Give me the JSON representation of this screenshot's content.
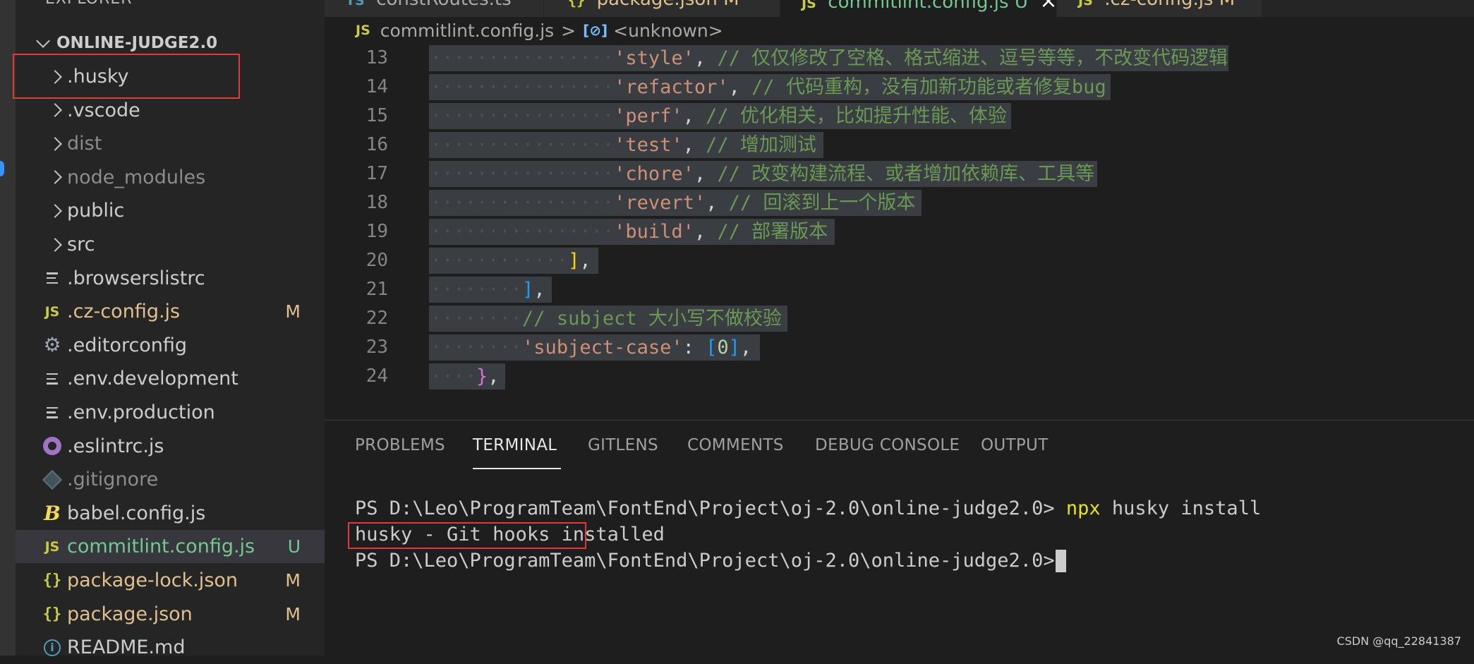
{
  "explorer": {
    "title": "EXPLORER",
    "root": "ONLINE-JUDGE2.0",
    "items": [
      {
        "label": ".husky",
        "kind": "folder",
        "badge": ""
      },
      {
        "label": ".vscode",
        "kind": "folder",
        "badge": ""
      },
      {
        "label": "dist",
        "kind": "folder",
        "badge": ""
      },
      {
        "label": "node_modules",
        "kind": "folder",
        "badge": ""
      },
      {
        "label": "public",
        "kind": "folder",
        "badge": ""
      },
      {
        "label": "src",
        "kind": "folder",
        "badge": ""
      },
      {
        "label": ".browserslistrc",
        "kind": "text",
        "badge": ""
      },
      {
        "label": ".cz-config.js",
        "kind": "js",
        "badge": "M"
      },
      {
        "label": ".editorconfig",
        "kind": "gear",
        "badge": ""
      },
      {
        "label": ".env.development",
        "kind": "text",
        "badge": ""
      },
      {
        "label": ".env.production",
        "kind": "text",
        "badge": ""
      },
      {
        "label": ".eslintrc.js",
        "kind": "eslint",
        "badge": ""
      },
      {
        "label": ".gitignore",
        "kind": "git",
        "badge": ""
      },
      {
        "label": "babel.config.js",
        "kind": "babel",
        "badge": ""
      },
      {
        "label": "commitlint.config.js",
        "kind": "js",
        "badge": "U"
      },
      {
        "label": "package-lock.json",
        "kind": "json",
        "badge": "M"
      },
      {
        "label": "package.json",
        "kind": "json",
        "badge": "M"
      },
      {
        "label": "README.md",
        "kind": "info",
        "badge": ""
      }
    ],
    "icon_text": {
      "js": "JS",
      "json": "{}",
      "babel": "B",
      "gear": "⚙",
      "info": "i"
    }
  },
  "tabs": [
    {
      "icon": "TS",
      "label": "constRoutes.ts",
      "badge": ""
    },
    {
      "icon": "{}",
      "label": "package.json",
      "badge": "M"
    },
    {
      "icon": "JS",
      "label": "commitlint.config.js",
      "badge": "U"
    },
    {
      "icon": "JS",
      "label": ".cz-config.js",
      "badge": "M"
    }
  ],
  "tab_close_glyph": "×",
  "breadcrumb": {
    "js_icon": "JS",
    "file": "commitlint.config.js",
    "separator": ">",
    "symbol_icon": "[⊘]",
    "symbol": "<unknown>"
  },
  "editor": {
    "lines": [
      {
        "n": "13",
        "ws": "················",
        "parts": [
          [
            "str",
            "'style'"
          ],
          [
            "pun",
            ", "
          ],
          [
            "cm",
            "// 仅仅修改了空格、格式缩进、逗号等等，不改变代码逻辑"
          ]
        ]
      },
      {
        "n": "14",
        "ws": "················",
        "parts": [
          [
            "str",
            "'refactor'"
          ],
          [
            "pun",
            ", "
          ],
          [
            "cm",
            "// 代码重构，没有加新功能或者修复bug"
          ]
        ]
      },
      {
        "n": "15",
        "ws": "················",
        "parts": [
          [
            "str",
            "'perf'"
          ],
          [
            "pun",
            ", "
          ],
          [
            "cm",
            "// 优化相关，比如提升性能、体验"
          ]
        ]
      },
      {
        "n": "16",
        "ws": "················",
        "parts": [
          [
            "str",
            "'test'"
          ],
          [
            "pun",
            ", "
          ],
          [
            "cm",
            "// 增加测试"
          ]
        ]
      },
      {
        "n": "17",
        "ws": "················",
        "parts": [
          [
            "str",
            "'chore'"
          ],
          [
            "pun",
            ", "
          ],
          [
            "cm",
            "// 改变构建流程、或者增加依赖库、工具等"
          ]
        ]
      },
      {
        "n": "18",
        "ws": "················",
        "parts": [
          [
            "str",
            "'revert'"
          ],
          [
            "pun",
            ", "
          ],
          [
            "cm",
            "// 回滚到上一个版本"
          ]
        ]
      },
      {
        "n": "19",
        "ws": "················",
        "parts": [
          [
            "str",
            "'build'"
          ],
          [
            "pun",
            ", "
          ],
          [
            "cm",
            "// 部署版本"
          ]
        ]
      },
      {
        "n": "20",
        "ws": "············",
        "parts": [
          [
            "br-y",
            "]"
          ],
          [
            "pun",
            ","
          ]
        ]
      },
      {
        "n": "21",
        "ws": "········",
        "parts": [
          [
            "br-b",
            "]"
          ],
          [
            "pun",
            ","
          ]
        ]
      },
      {
        "n": "22",
        "ws": "········",
        "parts": [
          [
            "cm",
            "// subject 大小写不做校验"
          ]
        ]
      },
      {
        "n": "23",
        "ws": "········",
        "parts": [
          [
            "str",
            "'subject-case'"
          ],
          [
            "pun",
            ": "
          ],
          [
            "br-b",
            "["
          ],
          [
            "num",
            "0"
          ],
          [
            "br-b",
            "]"
          ],
          [
            "pun",
            ","
          ]
        ]
      },
      {
        "n": "24",
        "ws": "····",
        "parts": [
          [
            "br-p",
            "}"
          ],
          [
            "pun",
            ","
          ]
        ]
      }
    ]
  },
  "panel": {
    "tabs": [
      "PROBLEMS",
      "TERMINAL",
      "GITLENS",
      "COMMENTS",
      "DEBUG CONSOLE",
      "OUTPUT"
    ],
    "active_tab": "TERMINAL",
    "terminal": {
      "prompt": "PS D:\\Leo\\ProgramTeam\\FontEnd\\Project\\oj-2.0\\online-judge2.0> ",
      "command_bin": "npx",
      "command_args": " husky install",
      "output": "husky - Git hooks installed",
      "prompt2": "PS D:\\Leo\\ProgramTeam\\FontEnd\\Project\\oj-2.0\\online-judge2.0> "
    }
  },
  "watermark": "CSDN @qq_22841387",
  "colors": {
    "accent_red": "#e53935",
    "modified": "#e2c08d",
    "untracked": "#73c991"
  }
}
